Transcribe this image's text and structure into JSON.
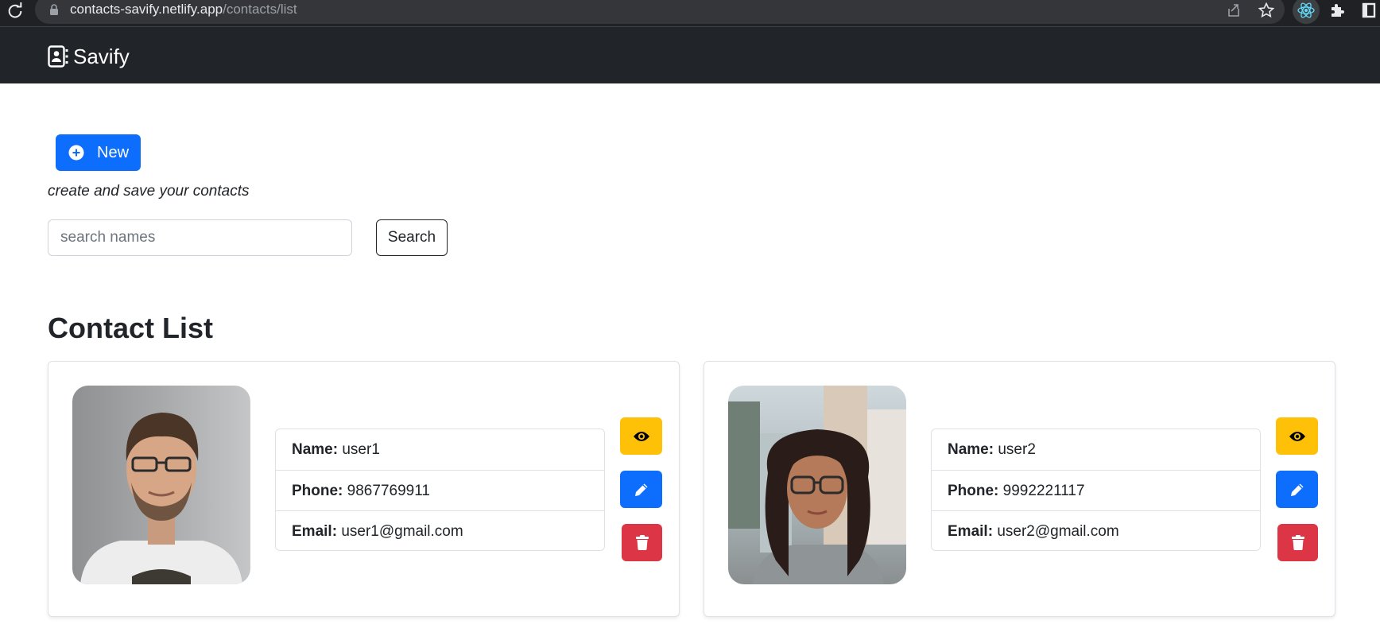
{
  "browser": {
    "url_host": "contacts-savify.netlify.app",
    "url_path": "/contacts/list",
    "icons": [
      "reload-icon",
      "lock-icon",
      "share-icon",
      "star-icon",
      "react-devtools-icon",
      "extensions-icon",
      "window-icon"
    ]
  },
  "navbar": {
    "brand": "Savify",
    "brand_icon": "contact-book-icon"
  },
  "toolbar": {
    "new_label": "New",
    "tagline": "create and save your contacts",
    "search_placeholder": "search names",
    "search_value": "",
    "search_label": "Search"
  },
  "main": {
    "title": "Contact List"
  },
  "contacts": [
    {
      "name_key": "Name:",
      "name": "user1",
      "phone_key": "Phone:",
      "phone": "9867769911",
      "email_key": "Email:",
      "email": "user1@gmail.com"
    },
    {
      "name_key": "Name:",
      "name": "user2",
      "phone_key": "Phone:",
      "phone": "9992221117",
      "email_key": "Email:",
      "email": "user2@gmail.com"
    }
  ],
  "colors": {
    "navbar": "#212529",
    "primary": "#0d6efd",
    "warning": "#ffc107",
    "danger": "#dc3545"
  }
}
